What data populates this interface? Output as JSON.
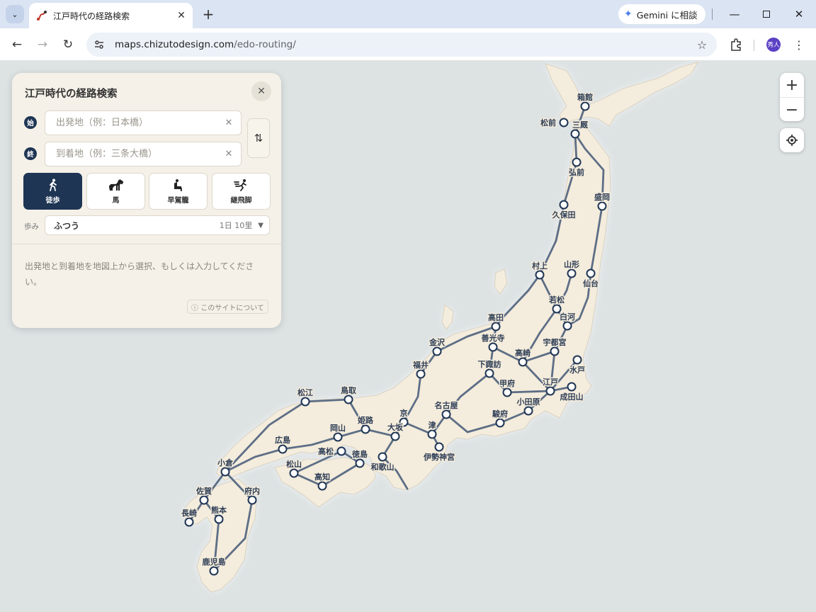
{
  "browser": {
    "tab_title": "江戸時代の経路検索",
    "gemini_label": "Gemini に相談",
    "url_domain": "maps.chizutodesign.com",
    "url_path": "/edo-routing/",
    "avatar_text": "秀人"
  },
  "panel": {
    "title": "江戸時代の経路検索",
    "start_badge": "始",
    "end_badge": "終",
    "start_placeholder": "出発地（例：日本橋）",
    "end_placeholder": "到着地（例：三条大橋）",
    "modes": [
      {
        "label": "徒歩",
        "icon": "walk-icon",
        "active": true
      },
      {
        "label": "馬",
        "icon": "horse-icon",
        "active": false
      },
      {
        "label": "早駕籠",
        "icon": "palanquin-icon",
        "active": false
      },
      {
        "label": "継飛脚",
        "icon": "courier-icon",
        "active": false
      }
    ],
    "pace_label": "歩み",
    "pace_value": "ふつう",
    "pace_detail": "1日 10里",
    "hint": "出発地と到着地を地図上から選択、もしくは入力してください。",
    "about": "ⓘ このサイトについて"
  },
  "map": {
    "cities": [
      {
        "name": "箱館"
      },
      {
        "name": "松前"
      },
      {
        "name": "三厩"
      },
      {
        "name": "弘前"
      },
      {
        "name": "盛岡"
      },
      {
        "name": "久保田"
      },
      {
        "name": "村上"
      },
      {
        "name": "山形"
      },
      {
        "name": "仙台"
      },
      {
        "name": "若松"
      },
      {
        "name": "白河"
      },
      {
        "name": "高田"
      },
      {
        "name": "善光寺"
      },
      {
        "name": "宇都宮"
      },
      {
        "name": "金沢"
      },
      {
        "name": "高崎"
      },
      {
        "name": "福井"
      },
      {
        "name": "下諏訪"
      },
      {
        "name": "水戸"
      },
      {
        "name": "甲府"
      },
      {
        "name": "江戸"
      },
      {
        "name": "成田山"
      },
      {
        "name": "小田原"
      },
      {
        "name": "松江"
      },
      {
        "name": "鳥取"
      },
      {
        "name": "名古屋"
      },
      {
        "name": "京"
      },
      {
        "name": "駿府"
      },
      {
        "name": "姫路"
      },
      {
        "name": "岡山"
      },
      {
        "name": "大坂"
      },
      {
        "name": "津"
      },
      {
        "name": "広島"
      },
      {
        "name": "高松"
      },
      {
        "name": "徳島"
      },
      {
        "name": "和歌山"
      },
      {
        "name": "伊勢神宮"
      },
      {
        "name": "小倉"
      },
      {
        "name": "松山"
      },
      {
        "name": "高知"
      },
      {
        "name": "佐賀"
      },
      {
        "name": "府内"
      },
      {
        "name": "熊本"
      },
      {
        "name": "長崎"
      },
      {
        "name": "鹿児島"
      }
    ]
  },
  "colors": {
    "accent": "#1f3554",
    "land": "#f4ecdc",
    "sea": "#dde2e3",
    "route": "#5d6e86"
  }
}
